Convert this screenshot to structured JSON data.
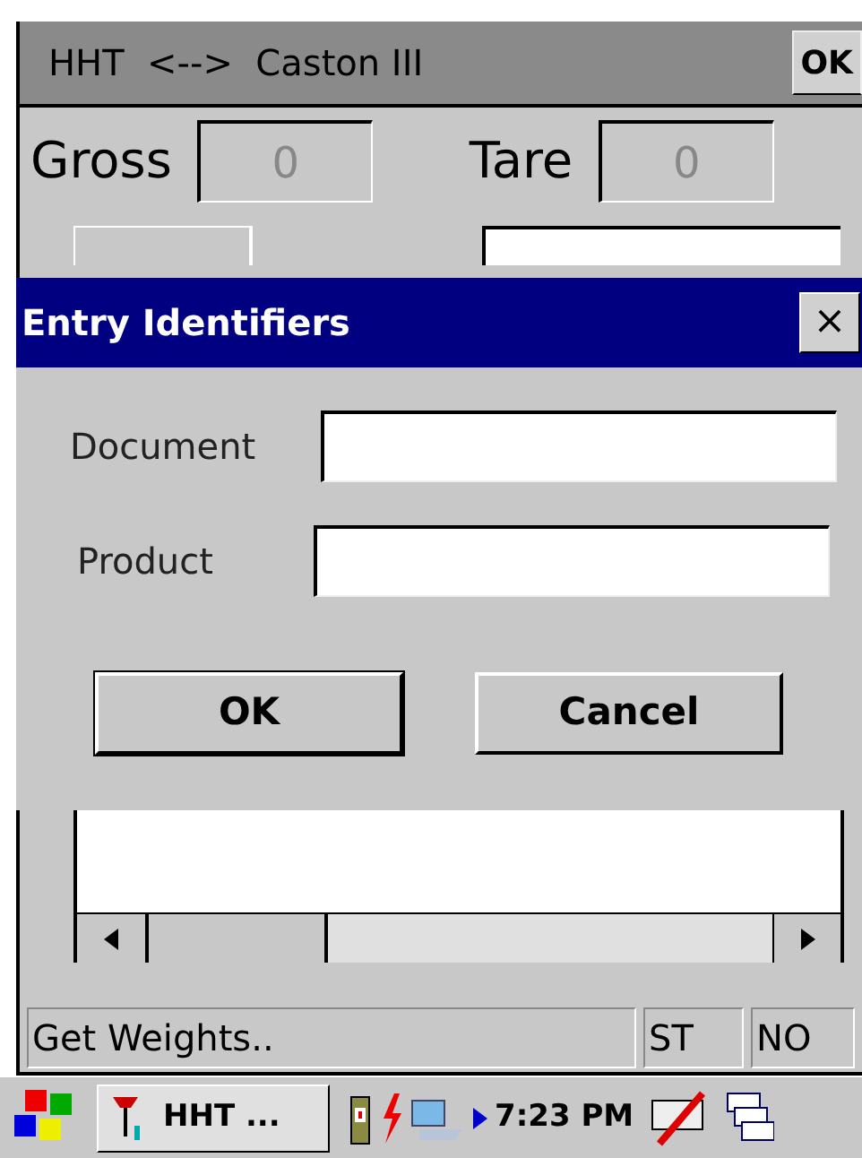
{
  "app": {
    "title": "HHT  <-->  Caston III",
    "ok_button": "OK"
  },
  "weights": [
    {
      "label": "Gross",
      "value": "0"
    },
    {
      "label": "Tare",
      "value": "0"
    }
  ],
  "dialog": {
    "title": "Entry Identifiers",
    "close": "×",
    "fields": [
      {
        "label": "Document"
      },
      {
        "label": "Product"
      }
    ],
    "buttons": [
      "OK",
      "Cancel"
    ]
  },
  "status_bar": [
    "Get Weights..",
    "ST",
    "NO"
  ],
  "taskbar": {
    "task": "HHT ...",
    "clock": "7:23 PM"
  }
}
